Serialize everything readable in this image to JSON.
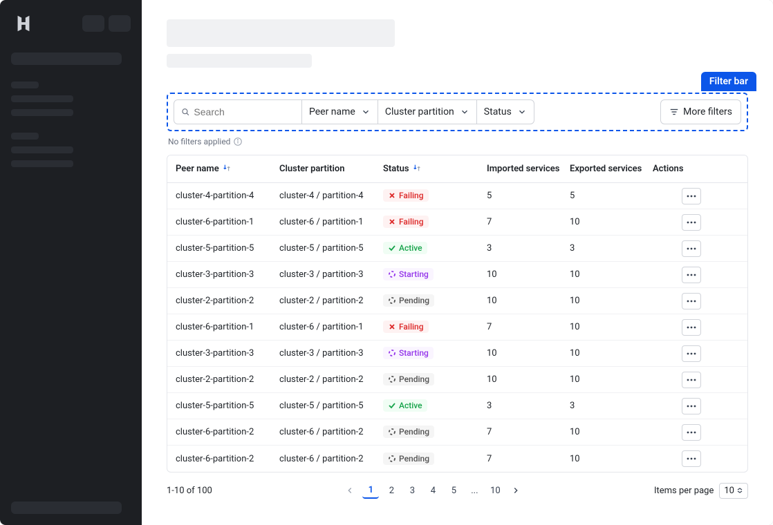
{
  "callout": "Filter bar",
  "filters": {
    "search_placeholder": "Search",
    "peer_label": "Peer name",
    "cluster_label": "Cluster partition",
    "status_label": "Status",
    "more_label": "More filters",
    "no_filters": "No filters applied"
  },
  "columns": {
    "peer": "Peer name",
    "cluster": "Cluster partition",
    "status": "Status",
    "imported": "Imported services",
    "exported": "Exported services",
    "actions": "Actions"
  },
  "rows": [
    {
      "peer": "cluster-4-partition-4",
      "cluster": "cluster-4 / partition-4",
      "status": "Failing",
      "status_kind": "failing",
      "imported": "5",
      "exported": "5"
    },
    {
      "peer": "cluster-6-partition-1",
      "cluster": "cluster-6 / partition-1",
      "status": "Failing",
      "status_kind": "failing",
      "imported": "7",
      "exported": "10"
    },
    {
      "peer": "cluster-5-partition-5",
      "cluster": "cluster-5 / partition-5",
      "status": "Active",
      "status_kind": "active",
      "imported": "3",
      "exported": "3"
    },
    {
      "peer": "cluster-3-partition-3",
      "cluster": "cluster-3 / partition-3",
      "status": "Starting",
      "status_kind": "starting",
      "imported": "10",
      "exported": "10"
    },
    {
      "peer": "cluster-2-partition-2",
      "cluster": "cluster-2 / partition-2",
      "status": "Pending",
      "status_kind": "pending",
      "imported": "10",
      "exported": "10"
    },
    {
      "peer": "cluster-6-partition-1",
      "cluster": "cluster-6 / partition-1",
      "status": "Failing",
      "status_kind": "failing",
      "imported": "7",
      "exported": "10"
    },
    {
      "peer": "cluster-3-partition-3",
      "cluster": "cluster-3 / partition-3",
      "status": "Starting",
      "status_kind": "starting",
      "imported": "10",
      "exported": "10"
    },
    {
      "peer": "cluster-2-partition-2",
      "cluster": "cluster-2 / partition-2",
      "status": "Pending",
      "status_kind": "pending",
      "imported": "10",
      "exported": "10"
    },
    {
      "peer": "cluster-5-partition-5",
      "cluster": "cluster-5 / partition-5",
      "status": "Active",
      "status_kind": "active",
      "imported": "3",
      "exported": "3"
    },
    {
      "peer": "cluster-6-partition-2",
      "cluster": "cluster-6 / partition-2",
      "status": "Pending",
      "status_kind": "pending",
      "imported": "7",
      "exported": "10"
    },
    {
      "peer": "cluster-6-partition-2",
      "cluster": "cluster-6 / partition-2",
      "status": "Pending",
      "status_kind": "pending",
      "imported": "7",
      "exported": "10"
    }
  ],
  "pagination": {
    "summary": "1-10 of 100",
    "pages": [
      "1",
      "2",
      "3",
      "4",
      "5",
      "...",
      "10"
    ],
    "active": "1",
    "items_label": "Items per page",
    "items_value": "10"
  }
}
